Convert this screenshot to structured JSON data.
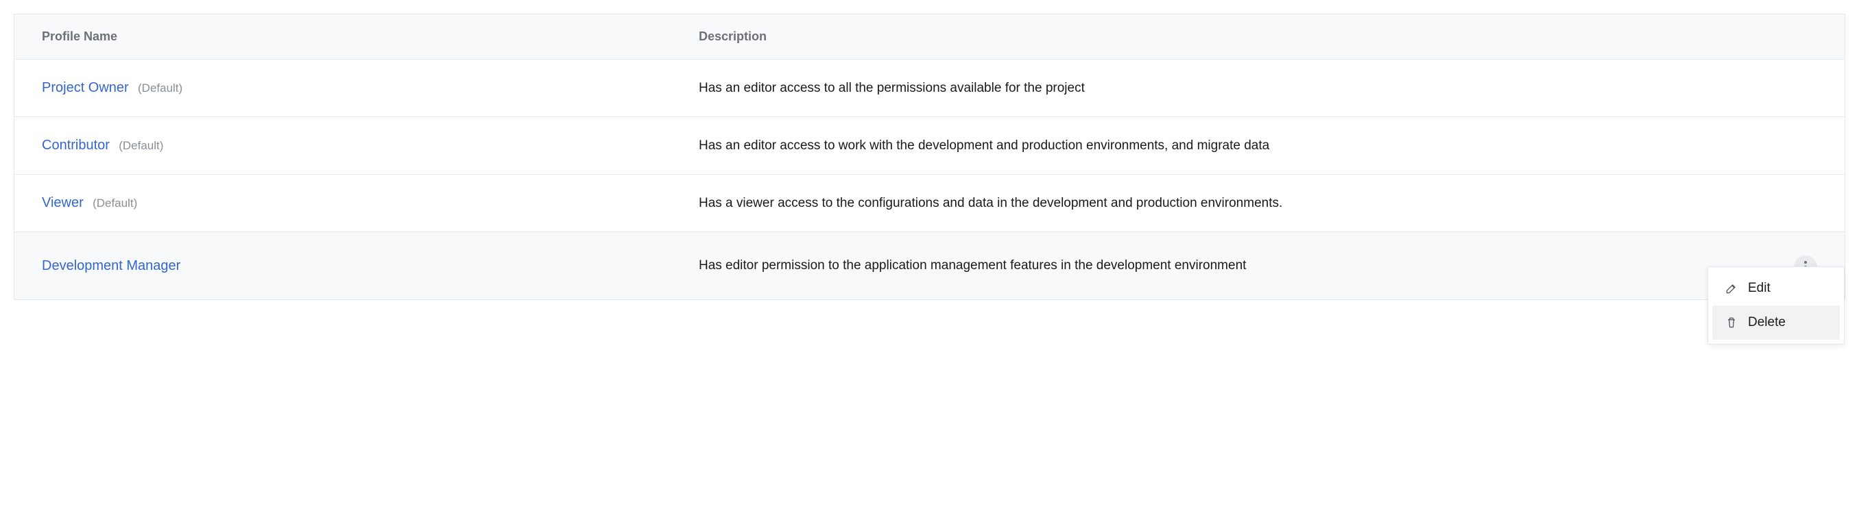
{
  "table": {
    "headers": {
      "name": "Profile Name",
      "description": "Description"
    },
    "default_tag": "(Default)",
    "rows": [
      {
        "name": "Project Owner",
        "is_default": true,
        "description": "Has an editor access to all the permissions available for the project"
      },
      {
        "name": "Contributor",
        "is_default": true,
        "description": "Has an editor access to work with the development and production environments, and migrate data"
      },
      {
        "name": "Viewer",
        "is_default": true,
        "description": "Has a viewer access to the configurations and data in the development and production environments."
      },
      {
        "name": "Development Manager",
        "is_default": false,
        "description": "Has editor permission to the application management features in the development environment"
      }
    ]
  },
  "menu": {
    "edit": "Edit",
    "delete": "Delete"
  }
}
